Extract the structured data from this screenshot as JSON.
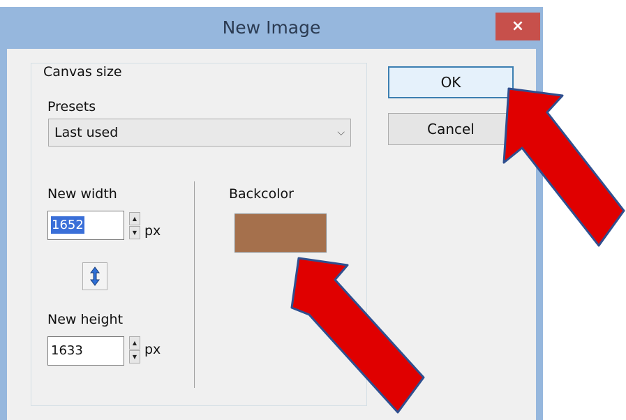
{
  "dialog": {
    "title": "New Image",
    "close_symbol": "×"
  },
  "canvas_size": {
    "group_label": "Canvas size",
    "presets_label": "Presets",
    "preset_value": "Last used",
    "width_label": "New width",
    "width_value": "1652",
    "width_unit": "px",
    "height_label": "New height",
    "height_value": "1633",
    "height_unit": "px",
    "link_icon": "vertical-double-arrow-icon"
  },
  "backcolor": {
    "label": "Backcolor",
    "color": "#a5704c"
  },
  "buttons": {
    "ok_label": "OK",
    "cancel_label": "Cancel"
  },
  "annotations": {
    "arrow_color": "#e00000",
    "arrow_outline": "#2f4f8f"
  }
}
